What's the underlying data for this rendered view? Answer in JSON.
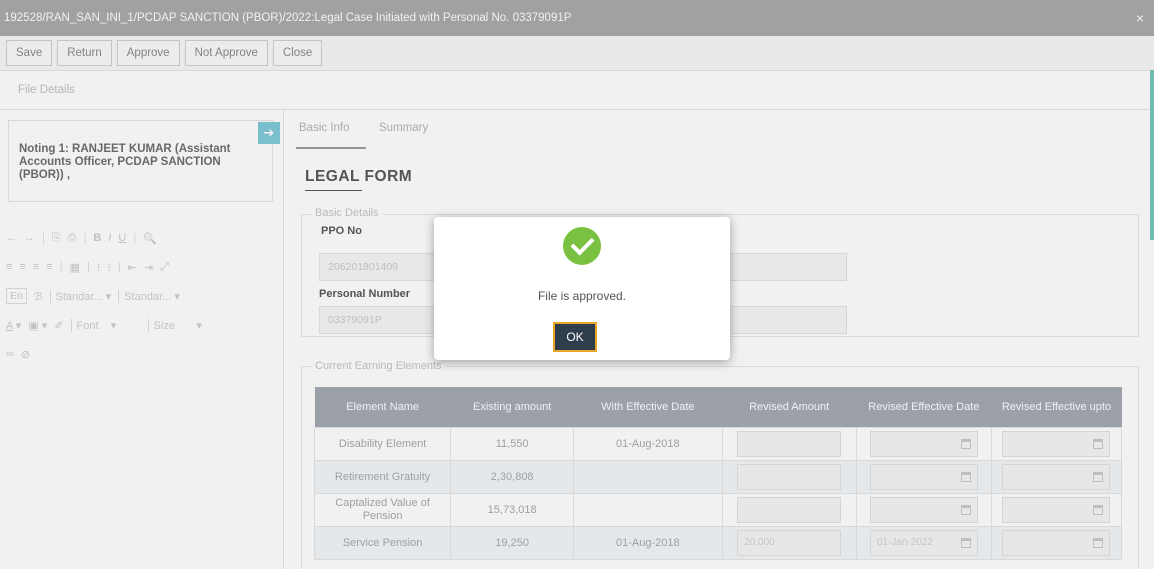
{
  "window": {
    "title": "192528/RAN_SAN_INI_1/PCDAP SANCTION (PBOR)/2022:Legal Case Initiated with Personal No. 03379091P",
    "close_glyph": "×"
  },
  "toolbar": {
    "save": "Save",
    "return": "Return",
    "approve": "Approve",
    "not_approve": "Not Approve",
    "close": "Close"
  },
  "file_details": "File Details",
  "noting": {
    "text": "Noting 1: RANJEET KUMAR (Assistant Accounts Officer, PCDAP SANCTION (PBOR)) ,",
    "arrow_glyph": "➔"
  },
  "editor": {
    "row1": [
      "←",
      "→",
      "⎘",
      "⎙",
      "B",
      "I",
      "U",
      "🔍"
    ],
    "row2": [
      "≡",
      "≡",
      "≡",
      "≡",
      "▦",
      "⁝",
      "⁝",
      "⇤",
      "⇥",
      "⤢"
    ],
    "lang": "En",
    "style_glyph": "ℬ",
    "style1": "Standar...",
    "style2": "Standar...",
    "font": "Font",
    "size": "Size",
    "text_color": "A",
    "bg_color": "▣",
    "brush": "✐",
    "link1": "∞",
    "link2": "⊘",
    "dropdown_glyph": "▾"
  },
  "tabs": {
    "basic_info": "Basic Info",
    "summary": "Summary"
  },
  "form": {
    "title": "LEGAL FORM",
    "basic_details": "Basic Details",
    "ppo_label": "PPO No",
    "ppo_value": "206201801409",
    "personal_label": "Personal Number",
    "personal_value": "03379091P",
    "current_earning": "Current Earning Elements"
  },
  "table": {
    "headers": [
      "Element Name",
      "Existing amount",
      "With Effective Date",
      "Revised Amount",
      "Revised Effective Date",
      "Revised Effective upto"
    ],
    "rows": [
      {
        "name": "Disability Element",
        "existing": "11,550",
        "date": "01-Aug-2018",
        "revised": "",
        "rev_date": ""
      },
      {
        "name": "Retirement Gratuity",
        "existing": "2,30,808",
        "date": "",
        "revised": "",
        "rev_date": ""
      },
      {
        "name": "Captalized Value of Pension",
        "existing": "15,73,018",
        "date": "",
        "revised": "",
        "rev_date": ""
      },
      {
        "name": "Service Pension",
        "existing": "19,250",
        "date": "01-Aug-2018",
        "revised": "20,000",
        "rev_date": "01-Jan-2022"
      }
    ]
  },
  "modal": {
    "message": "File is approved.",
    "ok": "OK"
  },
  "colors": {
    "titlebar": "#a9a9a9",
    "success": "#7ac142",
    "ok_button": "#2f3e4d",
    "ok_focus": "#e8a628",
    "table_header": "#a3a9b1"
  }
}
